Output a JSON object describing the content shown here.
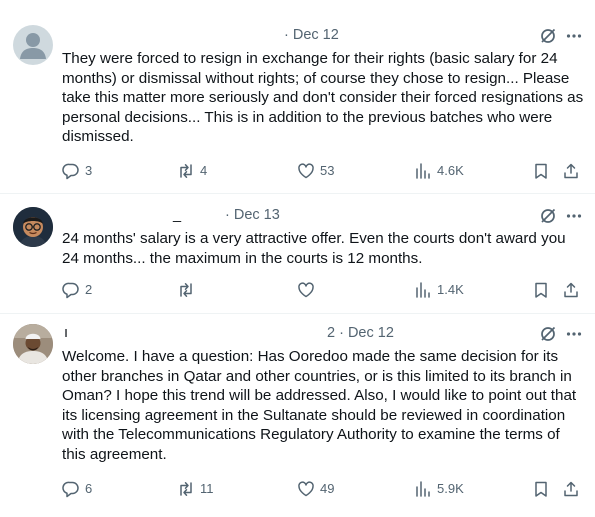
{
  "colors": {
    "text": "#0f1419",
    "secondary": "#536471",
    "divider": "#eff3f4"
  },
  "tweets": [
    {
      "name": "",
      "date": "· Dec 12",
      "text": "They were forced to resign in exchange for their rights (basic salary for 24 months) or dismissal without rights; of course they chose to resign... Please take this matter more seriously and don't consider their forced resignations as personal decisions... This is in addition to the previous batches who were dismissed.",
      "replies": "3",
      "reposts": "4",
      "likes": "53",
      "views": "4.6K"
    },
    {
      "name": "_",
      "date": "· Dec 13",
      "text": "24 months' salary is a very attractive offer. Even the courts don't award you 24 months... the maximum in the courts is 12 months.",
      "replies": "2",
      "reposts": "",
      "likes": "",
      "views": "1.4K"
    },
    {
      "name": "ı",
      "date": "2 · Dec 12",
      "text": "Welcome. I have a question: Has Ooredoo made the same decision for its other branches in Qatar and other countries, or is this limited to its branch in Oman? I hope this trend will be addressed. Also, I would like to point out that its licensing agreement in the Sultanate should be reviewed in coordination with the Telecommunications Regulatory Authority to examine the terms of this agreement.",
      "replies": "6",
      "reposts": "11",
      "likes": "49",
      "views": "5.9K"
    }
  ]
}
